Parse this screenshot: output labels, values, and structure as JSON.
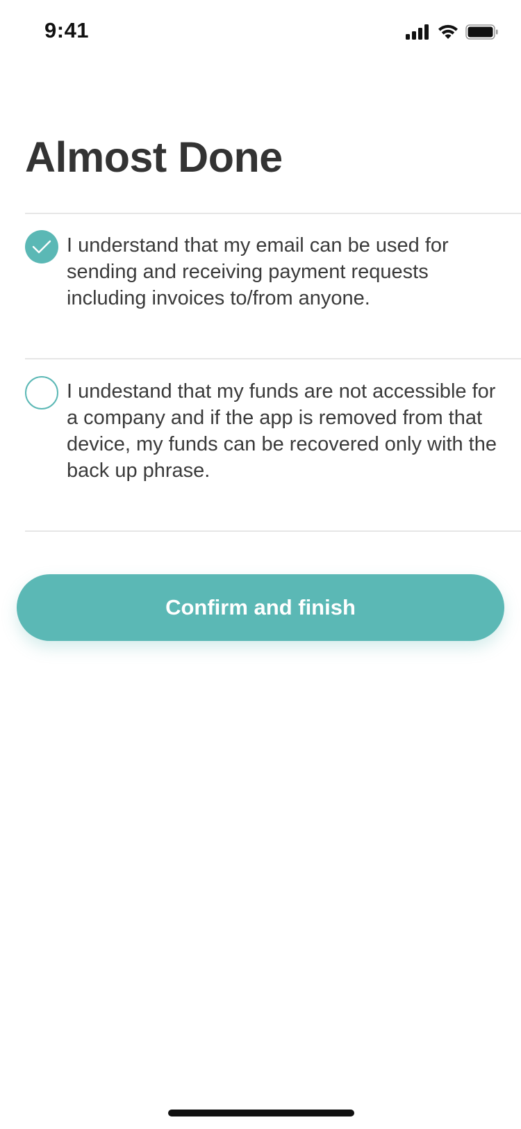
{
  "status_bar": {
    "time": "9:41",
    "icons": [
      "cellular-signal-icon",
      "wifi-icon",
      "battery-icon"
    ]
  },
  "page": {
    "title": "Almost Done"
  },
  "agreements": [
    {
      "checked": true,
      "text": "I understand that my email can be used for sending and receiving payment requests including invoices to/from anyone."
    },
    {
      "checked": false,
      "text": "I undestand that my funds are not accessible for a company and if the app is removed from that device, my funds can be recovered only with the back up phrase."
    }
  ],
  "actions": {
    "confirm_label": "Confirm and finish"
  },
  "colors": {
    "accent": "#5bb8b5",
    "text": "#333333",
    "divider": "#e6e6e6"
  }
}
